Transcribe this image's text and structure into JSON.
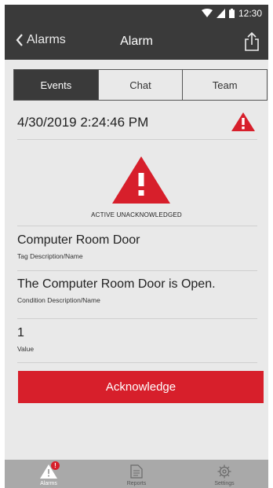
{
  "status_bar": {
    "time": "12:30"
  },
  "app_bar": {
    "back_label": "Alarms",
    "title": "Alarm"
  },
  "tabs": [
    {
      "label": "Events",
      "active": true
    },
    {
      "label": "Chat",
      "active": false
    },
    {
      "label": "Team",
      "active": false
    }
  ],
  "alarm": {
    "datetime": "4/30/2019 2:24:46 PM",
    "state": "ACTIVE UNACKNOWLEDGED",
    "tag_value": "Computer Room Door",
    "tag_label": "Tag Description/Name",
    "condition_value": "The Computer Room Door is Open.",
    "condition_label": "Condition Description/Name",
    "value": "1",
    "value_label": "Value"
  },
  "actions": {
    "acknowledge_label": "Acknowledge"
  },
  "bottom_nav": [
    {
      "label": "Alarms",
      "icon": "warning-icon",
      "active": true,
      "badge": "!"
    },
    {
      "label": "Reports",
      "icon": "document-icon",
      "active": false
    },
    {
      "label": "Settings",
      "icon": "gear-icon",
      "active": false
    }
  ],
  "colors": {
    "accent": "#d71f2b",
    "bar": "#3a3a3a",
    "background": "#e9e9e9",
    "nav": "#a9a9a9"
  }
}
